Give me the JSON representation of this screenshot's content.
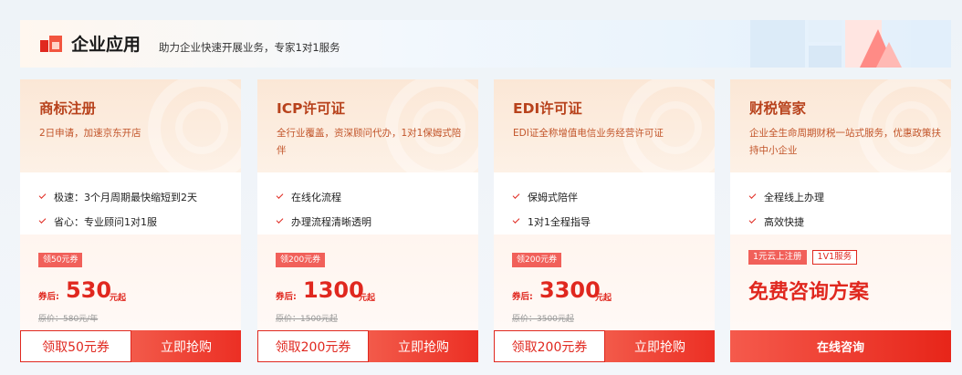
{
  "header": {
    "title": "企业应用",
    "subtitle": "助力企业快速开展业务，专家1对1服务"
  },
  "colors": {
    "accent": "#e0281f",
    "title_brown": "#b8421c",
    "card_top": "#fbe7d6"
  },
  "cards": [
    {
      "title": "商标注册",
      "desc": "2日申请，加速京东开店",
      "features": [
        "极速：3个月周期最快缩短到2天",
        "省心：专业顾问1对1服"
      ],
      "coupon_tag": "领50元券",
      "price_label": "券后:",
      "price": "530",
      "price_unit": "元起",
      "original_price": "原价：580元/年",
      "coupon_button": "领取50元券",
      "buy_button": "立即抢购"
    },
    {
      "title": "ICP许可证",
      "desc": "全行业覆盖，资深顾问代办，1对1保姆式陪伴",
      "features": [
        "在线化流程",
        "办理流程清晰透明"
      ],
      "coupon_tag": "领200元券",
      "price_label": "券后:",
      "price": "1300",
      "price_unit": "元起",
      "original_price": "原价：1500元起",
      "coupon_button": "领取200元券",
      "buy_button": "立即抢购"
    },
    {
      "title": "EDI许可证",
      "desc": "EDI证全称增值电信业务经营许可证",
      "features": [
        "保姆式陪伴",
        "1对1全程指导"
      ],
      "coupon_tag": "领200元券",
      "price_label": "券后:",
      "price": "3300",
      "price_unit": "元起",
      "original_price": "原价：3500元起",
      "coupon_button": "领取200元券",
      "buy_button": "立即抢购"
    },
    {
      "title": "财税管家",
      "desc": "企业全生命周期财税一站式服务，优惠政策扶持中小企业",
      "features": [
        "全程线上办理",
        "高效快捷"
      ],
      "tag_fill": "1元云上注册",
      "tag_outline": "1V1服务",
      "cta": "免费咨询方案",
      "consult_button": "在线咨询"
    }
  ]
}
